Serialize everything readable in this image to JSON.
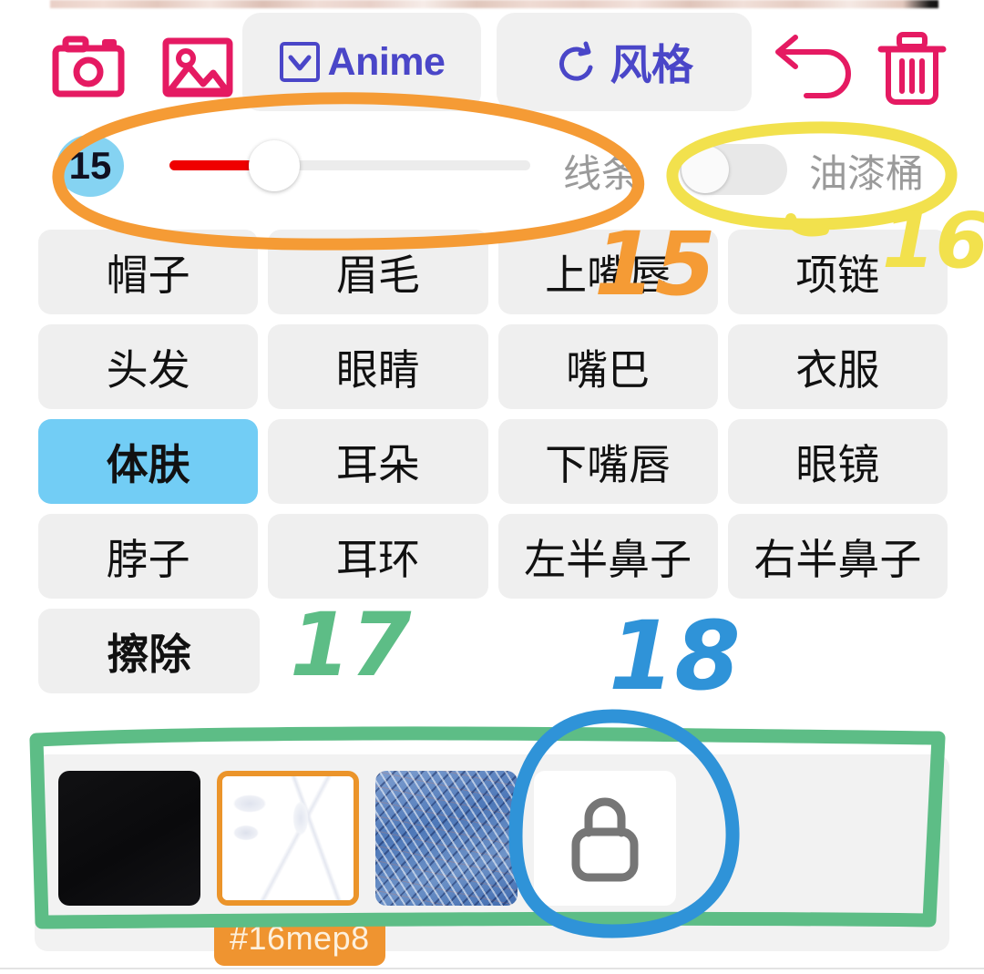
{
  "toolbar": {
    "camera_icon": "camera-icon",
    "gallery_icon": "image-icon",
    "anime_button": {
      "icon": "chevron-down-box-icon",
      "label": "Anime"
    },
    "style_button": {
      "icon": "refresh-ccw-icon",
      "label": "风格"
    },
    "undo_icon": "undo-arrow-icon",
    "delete_icon": "trash-icon"
  },
  "brush": {
    "size_value": "15",
    "line_label": "线条",
    "bucket_label": "油漆桶",
    "toggle_state": "off",
    "track_color": "#ececec",
    "fill_color": "#ef0000",
    "badge_color": "#85d3f2"
  },
  "parts": {
    "selected": "体肤",
    "rows": [
      [
        "帽子",
        "眉毛",
        "上嘴唇",
        "项链"
      ],
      [
        "头发",
        "眼睛",
        "嘴巴",
        "衣服"
      ],
      [
        "体肤",
        "耳朵",
        "下嘴唇",
        "眼镜"
      ],
      [
        "脖子",
        "耳环",
        "左半鼻子",
        "右半鼻子"
      ]
    ],
    "erase_label": "擦除"
  },
  "strip": {
    "items": [
      {
        "name": "thumbnail-dark",
        "selected": false
      },
      {
        "name": "thumbnail-sketch",
        "selected": true
      },
      {
        "name": "thumbnail-blue-texture",
        "selected": false
      },
      {
        "name": "thumbnail-locked",
        "icon": "lock-icon",
        "selected": false
      }
    ],
    "tag_label": "#16mep8",
    "tag_color": "#ef9430",
    "selected_border_color": "#eb942a"
  },
  "annotations": [
    {
      "id": "15",
      "color": "#f59b35",
      "target": "brush-size-slider-row"
    },
    {
      "id": "16",
      "color": "#f2e14d",
      "target": "paint-bucket-toggle"
    },
    {
      "id": "17",
      "color": "#5dbd86",
      "target": "thumbnail-strip"
    },
    {
      "id": "18",
      "color": "#2f93d8",
      "target": "locked-thumbnail"
    }
  ]
}
